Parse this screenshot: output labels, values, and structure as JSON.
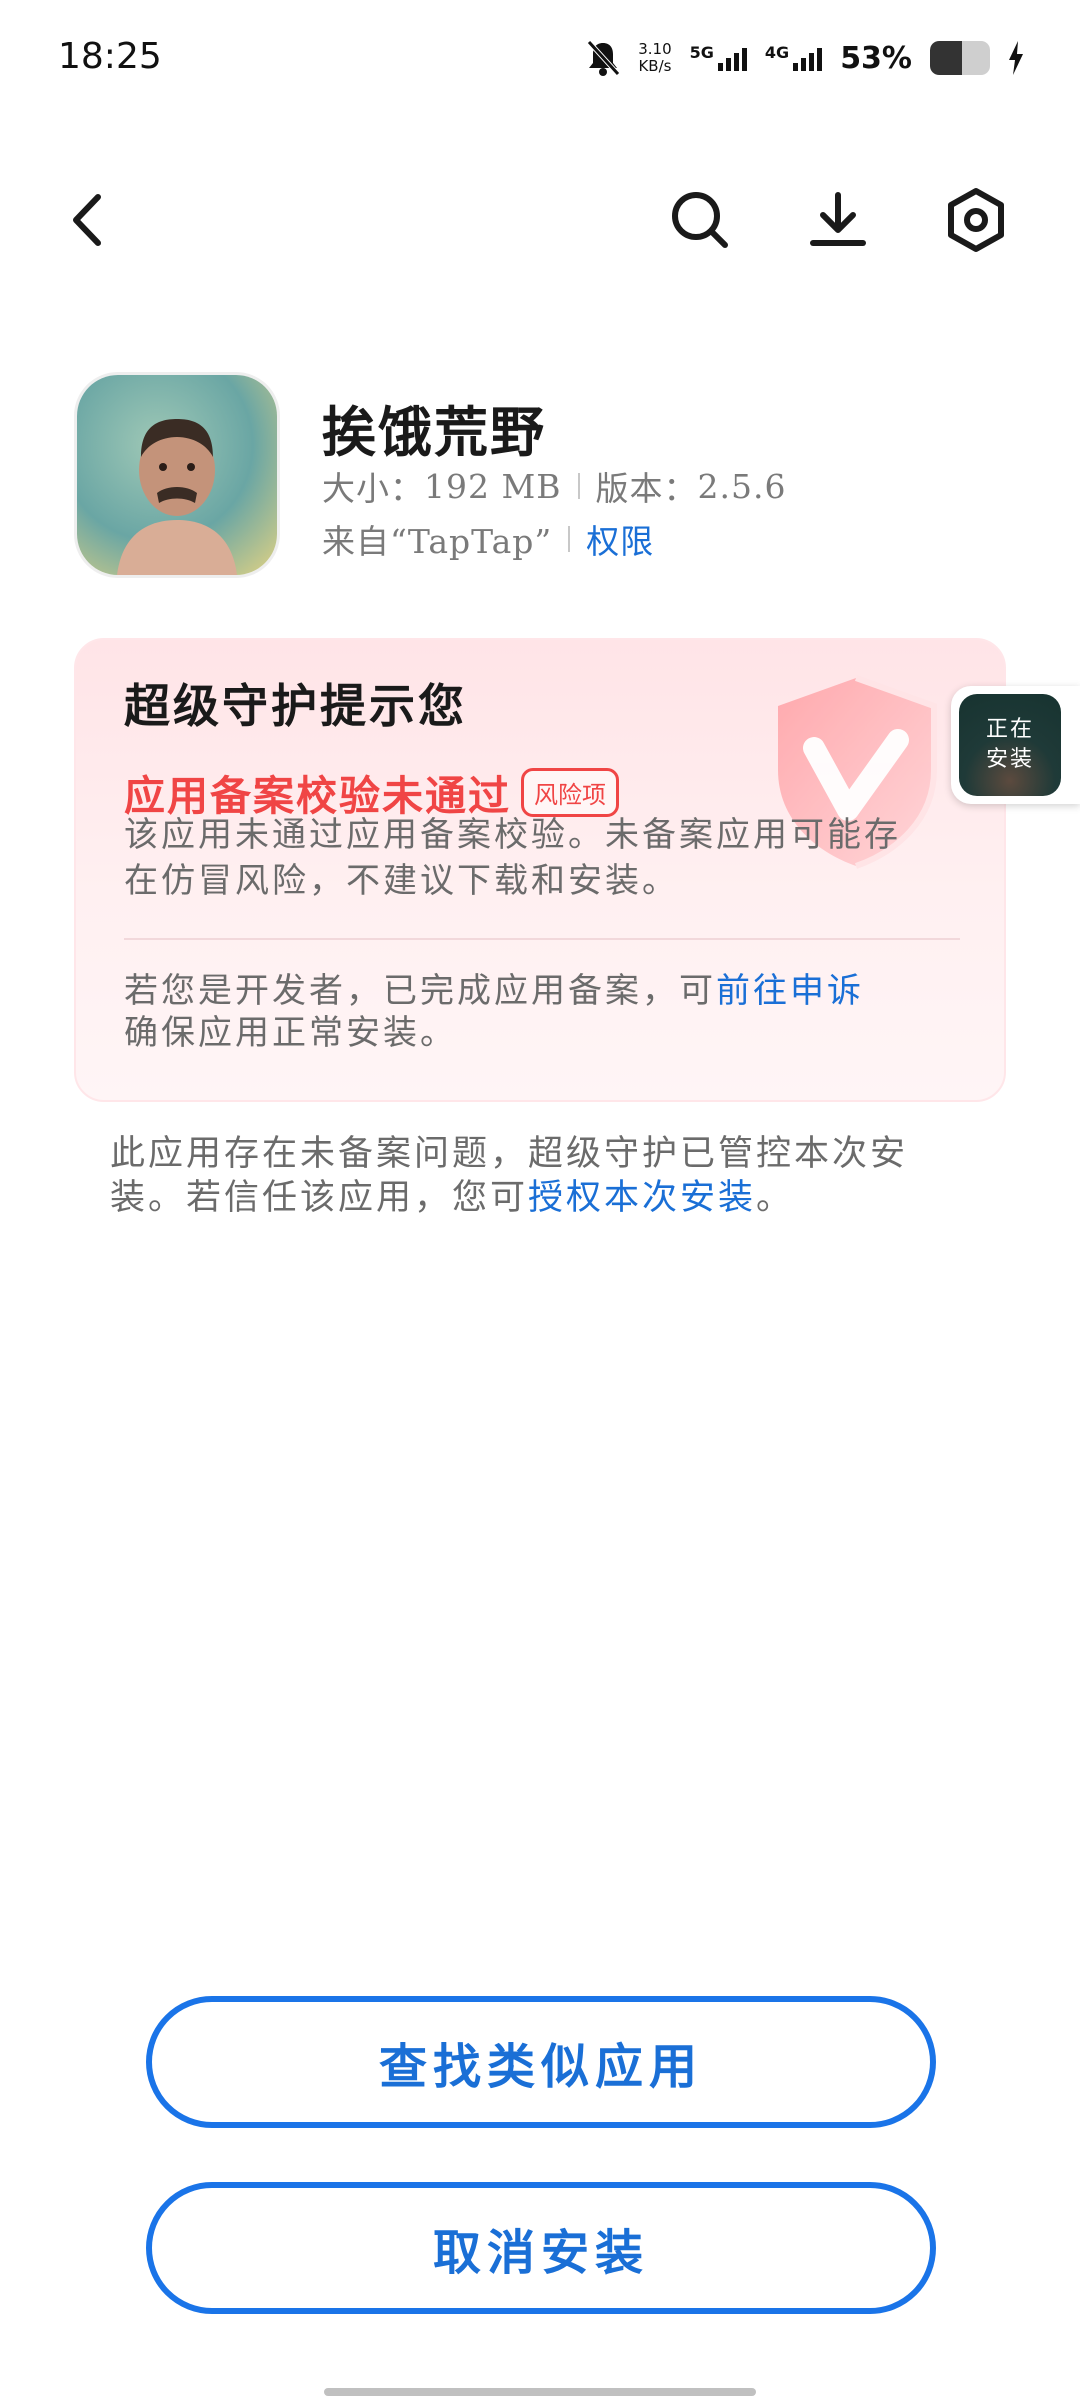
{
  "status_bar": {
    "time": "18:25",
    "speed_value": "3.10",
    "speed_unit": "KB/s",
    "network1": "5G",
    "network2": "4G",
    "battery_percent": "53%",
    "battery_level": 0.53
  },
  "nav": {
    "icons": [
      "back-icon",
      "search-icon",
      "download-icon",
      "settings-icon"
    ]
  },
  "app": {
    "name": "挨饿荒野",
    "size_label": "大小：",
    "size_value": "192 MB",
    "version_label": "版本：",
    "version_value": "2.5.6",
    "source": "来自“TapTap”",
    "permissions_link": "权限"
  },
  "card": {
    "title": "超级守护提示您",
    "alert": "应用备案校验未通过",
    "badge": "风险项",
    "description": "该应用未通过应用备案校验。未备案应用可能存在仿冒风险，不建议下载和安装。",
    "developer_text": "若您是开发者，已完成应用备案，可",
    "appeal_link": "前往申诉",
    "developer_text2": "确保应用正常安装。"
  },
  "install_bubble": {
    "line1": "正在",
    "line2": "安装"
  },
  "notice": {
    "text": "此应用存在未备案问题，超级守护已管控本次安装。若信任该应用，您可",
    "authorize_link": "授权本次安装",
    "tail": "。"
  },
  "buttons": {
    "find_similar": "查找类似应用",
    "cancel_install": "取消安装"
  },
  "colors": {
    "accent": "#1a6fd6",
    "danger": "#f04545"
  }
}
